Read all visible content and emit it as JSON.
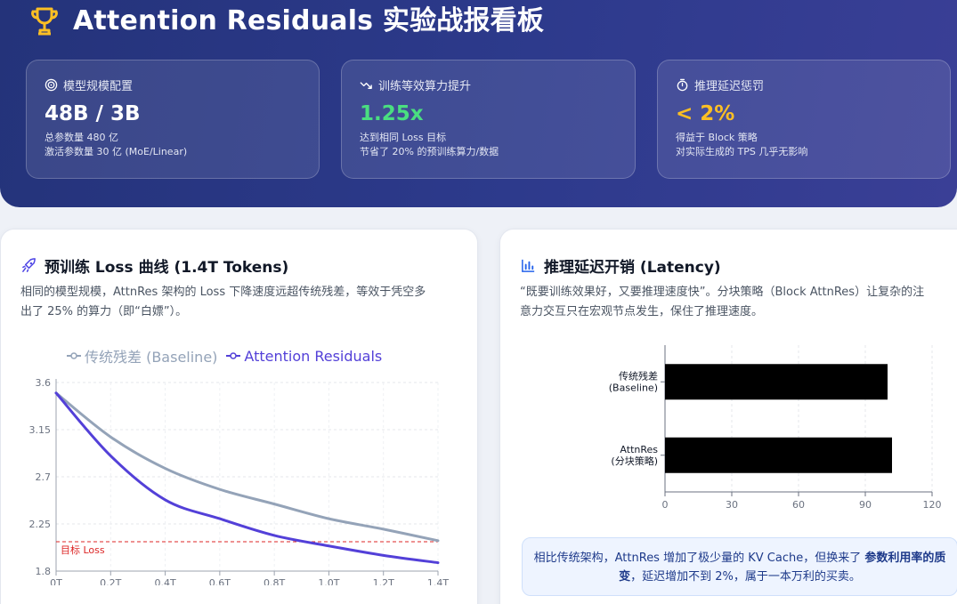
{
  "header": {
    "title": "Attention Residuals 实验战报看板",
    "icon": "trophy-icon"
  },
  "stats": [
    {
      "icon": "target-icon",
      "label": "模型规模配置",
      "value": "48B / 3B",
      "value_color": "#ffffff",
      "line1": "总参数量 480 亿",
      "line2": "激活参数量 30 亿 (MoE/Linear)"
    },
    {
      "icon": "trend-icon",
      "label": "训练等效算力提升",
      "value": "1.25x",
      "value_color": "#4ade80",
      "line1": "达到相同 Loss 目标",
      "line2": "节省了 20% 的预训练算力/数据"
    },
    {
      "icon": "stopwatch-icon",
      "label": "推理延迟惩罚",
      "value": "< 2%",
      "value_color": "#fbbf24",
      "line1": "得益于 Block 策略",
      "line2": "对实际生成的 TPS 几乎无影响"
    }
  ],
  "loss_card": {
    "title": "预训练 Loss 曲线 (1.4T Tokens)",
    "icon": "rocket-icon",
    "desc_line1": "相同的模型规模，AttnRes 架构的 Loss 下降速度远超传统残差，等效于凭空多",
    "desc_line2": "出了 25% 的算力（即“白嫖”）。"
  },
  "latency_card": {
    "title": "推理延迟开销 (Latency)",
    "icon": "bar-chart-icon",
    "desc_line1": "“既要训练效果好，又要推理速度快”。分块策略（Block AttnRes）让复杂的注",
    "desc_line2": "意力交互只在宏观节点发生，保住了推理速度。",
    "note_pre": "相比传统架构，AttnRes 增加了极少量的 KV Cache，但换来了",
    "note_bold": "参数利用率的质变",
    "note_post": "，延迟增加不到 2%，属于一本万利的买卖。"
  },
  "chart_data": [
    {
      "type": "line",
      "x": [
        "0T",
        "0.2T",
        "0.4T",
        "0.6T",
        "0.8T",
        "1.0T",
        "1.2T",
        "1.4T"
      ],
      "ylim": [
        1.8,
        3.6
      ],
      "yticks": [
        "1.8",
        "2.25",
        "2.7",
        "3.15",
        "3.6"
      ],
      "series": [
        {
          "name": "传统残差 (Baseline)",
          "color": "#94a3b8",
          "values": [
            3.5,
            3.08,
            2.78,
            2.58,
            2.44,
            2.3,
            2.2,
            2.09
          ]
        },
        {
          "name": "Attention Residuals",
          "color": "#5340d8",
          "values": [
            3.5,
            2.9,
            2.48,
            2.3,
            2.14,
            2.04,
            1.95,
            1.88
          ]
        }
      ],
      "target": {
        "value": 2.08,
        "label": "目标 Loss",
        "color": "#dc2626"
      }
    },
    {
      "type": "bar",
      "orientation": "horizontal",
      "categories": [
        {
          "line1": "传统残差",
          "line2": "(Baseline)"
        },
        {
          "line1": "AttnRes",
          "line2": "(分块策略)"
        }
      ],
      "values": [
        100,
        102
      ],
      "xlim": [
        0,
        120
      ],
      "xticks": [
        "0",
        "30",
        "60",
        "90",
        "120"
      ],
      "color": "#000000"
    }
  ]
}
